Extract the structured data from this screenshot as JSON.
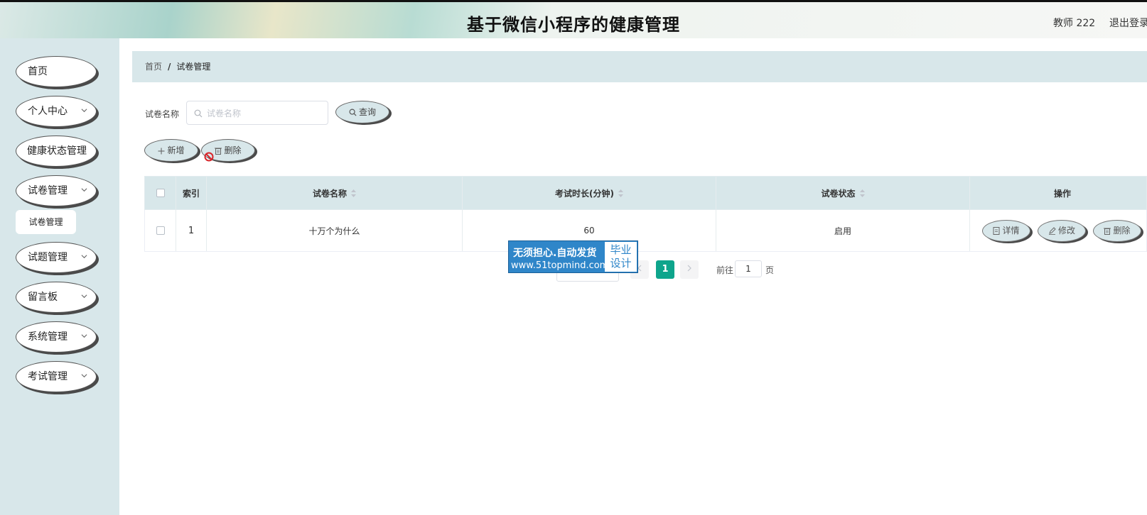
{
  "header": {
    "title": "基于微信小程序的健康管理",
    "user": "教师 222",
    "logout": "退出登录"
  },
  "sidebar": {
    "items": [
      {
        "label": "首页",
        "has_arrow": false
      },
      {
        "label": "个人中心",
        "has_arrow": true
      },
      {
        "label": "健康状态管理",
        "has_arrow": false
      },
      {
        "label": "试卷管理",
        "has_arrow": true
      },
      {
        "label": "试题管理",
        "has_arrow": true
      },
      {
        "label": "留言板",
        "has_arrow": true
      },
      {
        "label": "系统管理",
        "has_arrow": true
      },
      {
        "label": "考试管理",
        "has_arrow": true
      }
    ],
    "submenu": {
      "label": "试卷管理"
    }
  },
  "breadcrumb": {
    "home": "首页",
    "separator": "/",
    "current": "试卷管理"
  },
  "search": {
    "label": "试卷名称",
    "placeholder": "试卷名称",
    "value": "",
    "button": "查询"
  },
  "actions": {
    "add": "新增",
    "delete": "删除"
  },
  "table": {
    "columns": [
      "索引",
      "试卷名称",
      "考试时长(分钟)",
      "试卷状态",
      "操作"
    ],
    "rows": [
      {
        "index": "1",
        "name": "十万个为什么",
        "duration": "60",
        "status": "启用"
      }
    ],
    "row_actions": {
      "detail": "详情",
      "edit": "修改",
      "delete": "删除"
    }
  },
  "pagination": {
    "current_page": "1",
    "goto_label": "前往",
    "goto_value": "1",
    "page_suffix": "页"
  },
  "watermark": {
    "line1": "无须担心.自动发货",
    "line2": "www.51topmind.com",
    "box_line1": "毕业",
    "box_line2": "设计"
  },
  "colors": {
    "sidebar_bg": "#d8e7ea",
    "accent": "#0ea58c",
    "header_bg": "#d8e7ea"
  }
}
